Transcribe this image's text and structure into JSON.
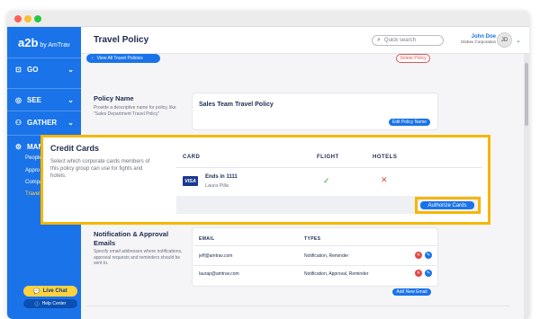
{
  "sidebar": {
    "logo": "a2b",
    "logo_sub": "by AmTrav",
    "nav": [
      {
        "label": "GO",
        "icon": "map-icon",
        "glyph": "⊡",
        "chevron": "⌄"
      },
      {
        "label": "SEE",
        "icon": "eye-icon",
        "glyph": "◎",
        "chevron": "⌄"
      },
      {
        "label": "GATHER",
        "icon": "people-icon",
        "glyph": "⚇",
        "chevron": "⌄"
      },
      {
        "label": "MANAGE",
        "icon": "gear-icon",
        "glyph": "⚙",
        "chevron": "⌃"
      }
    ],
    "sub_items": [
      "People",
      "Appro",
      "Compa",
      "Travel"
    ],
    "live_chat": "Live Chat",
    "help_center": "Help Center"
  },
  "header": {
    "title": "Travel Policy",
    "search_placeholder": "Quick search",
    "user_name": "John Doe",
    "user_company": "Globex Corporation",
    "avatar_initials": "JD"
  },
  "actions": {
    "view_all": "View All Travel Policies",
    "delete": "Delete Policy"
  },
  "policy_name": {
    "title": "Policy Name",
    "description": "Provide a descriptive name for policy, like \"Sales Department Travel Policy\"",
    "value": "Sales Team Travel Policy",
    "edit_button": "Edit Policy Name"
  },
  "credit_cards": {
    "title": "Credit Cards",
    "description": "Select which corporate cards members of this policy group can use for fights and hotels.",
    "columns": [
      "CARD",
      "FLIGHT",
      "HOTELS"
    ],
    "card_brand": "VISA",
    "card_ends": "Ends in 1111",
    "card_holder": "Laura Pilla",
    "flight_glyph": "✓",
    "hotels_glyph": "✕",
    "authorize_button": "Authorize Cards"
  },
  "notifications": {
    "title": "Notification & Approval Emails",
    "description": "Specify email addresses where notifications, approval requests and reminders should be sent to.",
    "columns": [
      "EMAIL",
      "TYPES"
    ],
    "rows": [
      {
        "email": "jeff@amtrav.com",
        "types": "Notification, Reminder"
      },
      {
        "email": "laurap@amtrav.com",
        "types": "Notification, Approval, Reminder"
      }
    ],
    "add_button": "Add New Email"
  }
}
